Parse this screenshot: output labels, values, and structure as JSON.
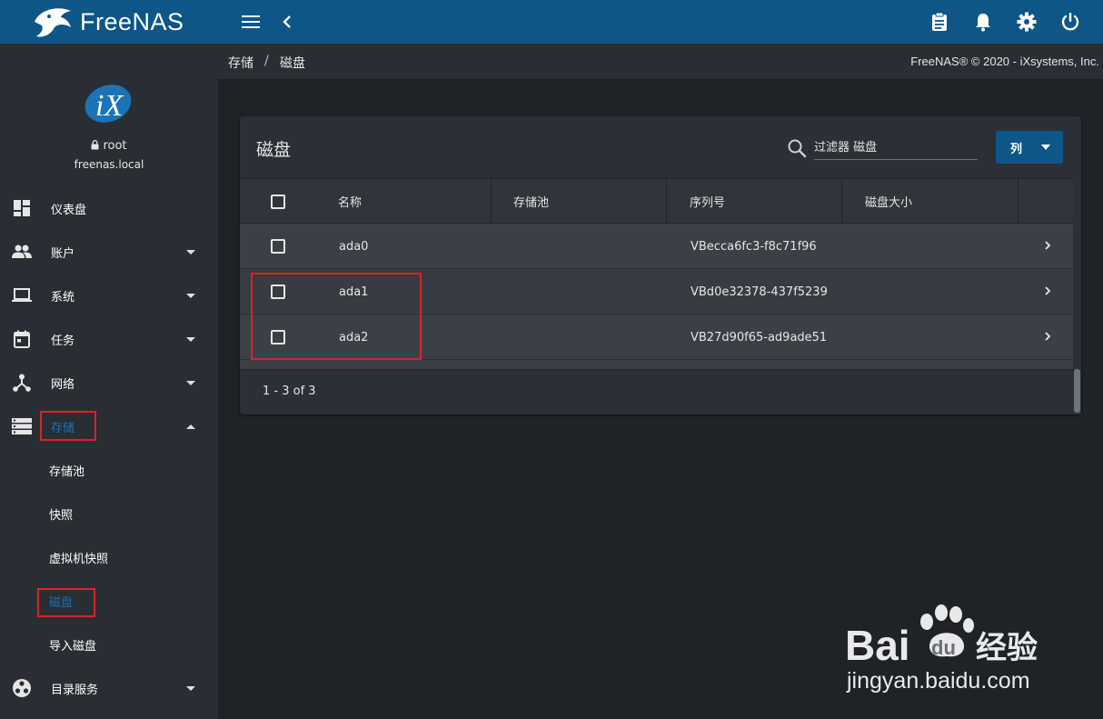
{
  "app": {
    "logo_text": "FreeNAS",
    "colors": {
      "brand": "#0d5687",
      "accent": "#1b73b8",
      "highlight": "#e02027"
    }
  },
  "topbar": {
    "icons": [
      "hamburger-menu-icon",
      "chevron-left-icon",
      "clipboard-icon",
      "bell-icon",
      "gear-icon",
      "power-icon"
    ]
  },
  "profile": {
    "username": "root",
    "hostname": "freenas.local"
  },
  "sidebar": {
    "items": [
      {
        "label": "仪表盘",
        "icon": "dashboard-icon"
      },
      {
        "label": "账户",
        "icon": "people-icon"
      },
      {
        "label": "系统",
        "icon": "laptop-icon"
      },
      {
        "label": "任务",
        "icon": "calendar-icon"
      },
      {
        "label": "网络",
        "icon": "network-icon"
      },
      {
        "label": "存储",
        "icon": "storage-icon"
      }
    ],
    "storage_sub": [
      "存储池",
      "快照",
      "虚拟机快照",
      "磁盘",
      "导入磁盘"
    ],
    "directory_services": {
      "label": "目录服务",
      "icon": "directory-icon"
    }
  },
  "breadcrumb": {
    "items": [
      "存储",
      "磁盘"
    ],
    "separator": "/",
    "copyright": "FreeNAS® © 2020 - iXsystems, Inc."
  },
  "card": {
    "title": "磁盘",
    "search_placeholder": "过滤器 磁盘",
    "columns_button": "列",
    "columns": [
      "名称",
      "存储池",
      "序列号",
      "磁盘大小"
    ],
    "rows": [
      {
        "name": "ada0",
        "pool": "",
        "serial": "VBecca6fc3-f8c71f96",
        "size": ""
      },
      {
        "name": "ada1",
        "pool": "",
        "serial": "VBd0e32378-437f5239",
        "size": ""
      },
      {
        "name": "ada2",
        "pool": "",
        "serial": "VB27d90f65-ad9ade51",
        "size": ""
      }
    ],
    "pagination": "1 - 3 of 3"
  },
  "watermark": {
    "brand": "Bai",
    "brand_du": "du",
    "brand_suffix": "经验",
    "url": "jingyan.baidu.com"
  }
}
